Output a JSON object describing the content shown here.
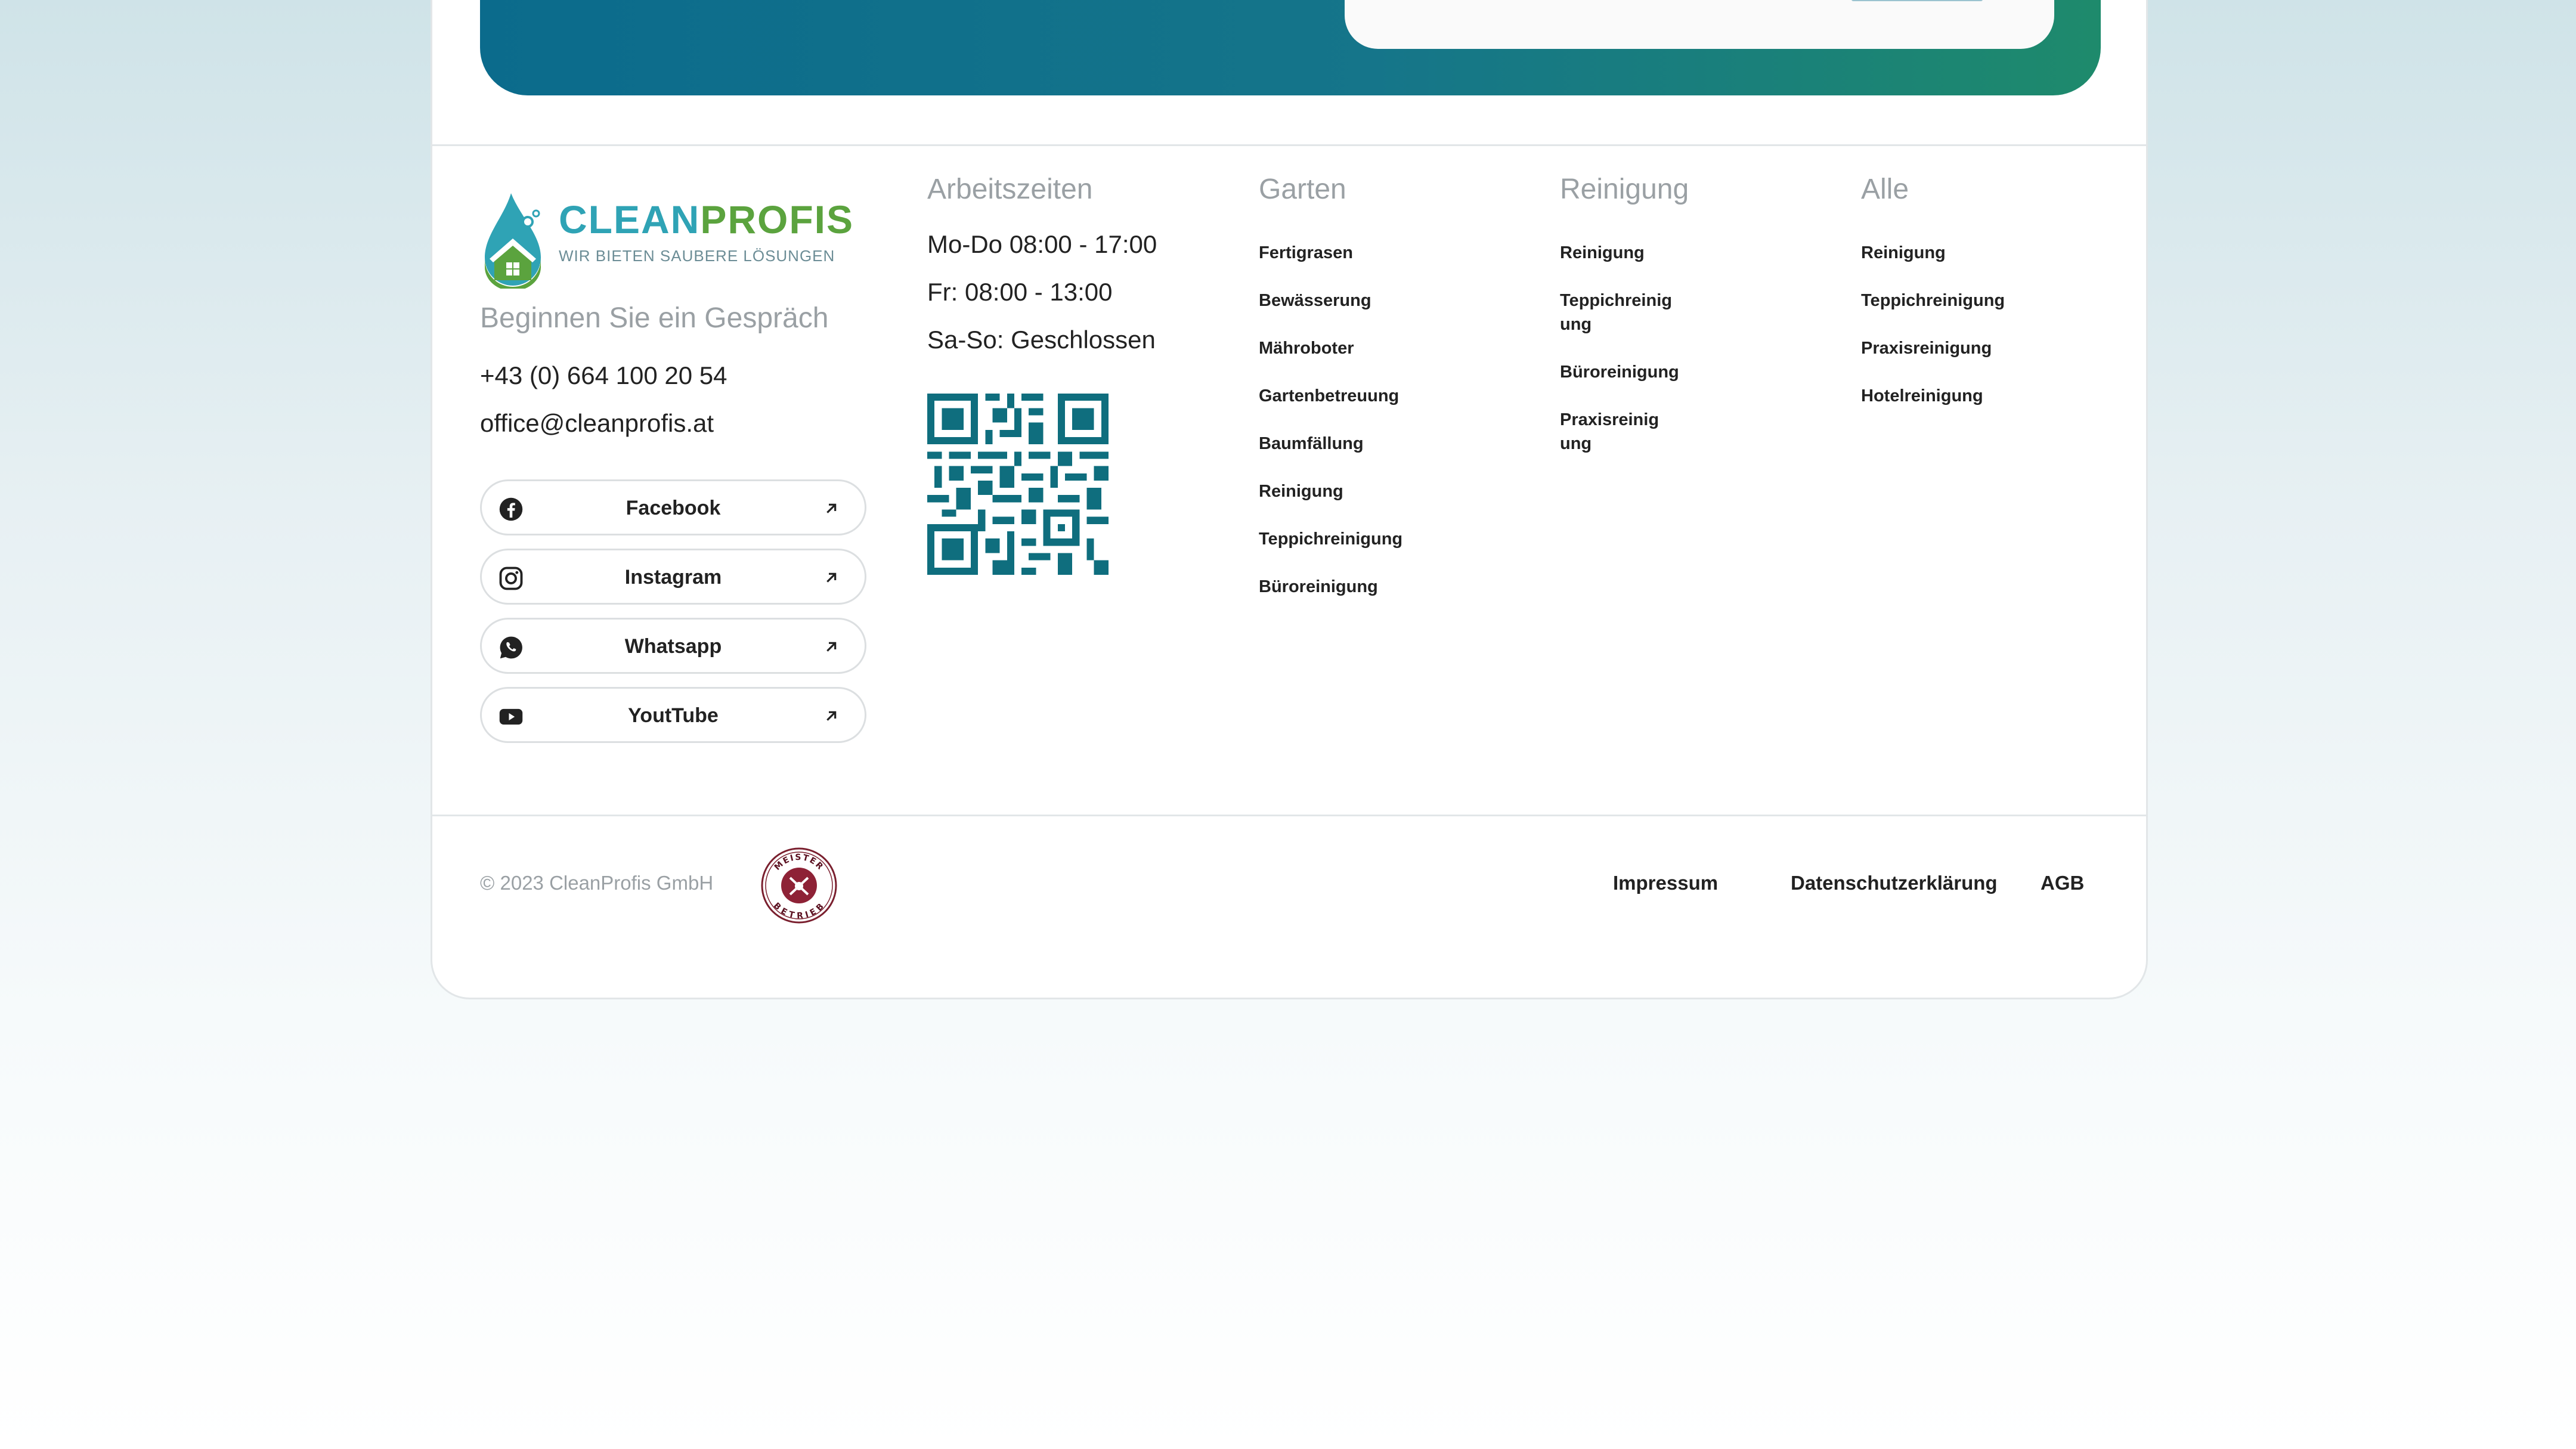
{
  "brand": {
    "name_part1": "CLEAN",
    "name_part2": "PROFIS",
    "tagline": "WIR BIETEN SAUBERE LÖSUNGEN",
    "primary_color": "#2fa3b5",
    "secondary_color": "#5ba33e",
    "dark_teal": "#0f6e7e"
  },
  "contact": {
    "heading": "Beginnen Sie ein Gespräch",
    "phone": "+43 (0) 664 100 20 54",
    "email": "office@cleanprofis.at"
  },
  "social": [
    {
      "label": "Facebook",
      "icon": "facebook-icon"
    },
    {
      "label": "Instagram",
      "icon": "instagram-icon"
    },
    {
      "label": "Whatsapp",
      "icon": "whatsapp-icon"
    },
    {
      "label": "YoutTube",
      "icon": "youtube-icon"
    }
  ],
  "hours": {
    "heading": "Arbeitszeiten",
    "lines": [
      "Mo-Do 08:00 - 17:00",
      "Fr: 08:00 - 13:00",
      "Sa-So: Geschlossen"
    ]
  },
  "columns": [
    {
      "heading": "Garten",
      "items": [
        "Fertigrasen",
        "Bewässerung",
        "Mähroboter",
        "Gartenbetreuung",
        "Baumfällung",
        "Reinigung",
        "Teppichreinigung",
        "Büroreinigung"
      ]
    },
    {
      "heading": "Reinigung",
      "items": [
        "Reinigung",
        "Teppichreinig ung",
        "Büroreinigung",
        "Praxisreinig ung"
      ]
    },
    {
      "heading": "Alle",
      "items": [
        "Reinigung",
        "Teppichreinigung",
        "Praxisreinigung",
        "Hotelreinigung"
      ]
    }
  ],
  "footer": {
    "copyright": "© 2023 CleanProfis GmbH",
    "seal_top": "MEISTER",
    "seal_bottom": "BETRIEB",
    "links": [
      "Impressum",
      "Datenschutzerklärung",
      "AGB"
    ]
  }
}
